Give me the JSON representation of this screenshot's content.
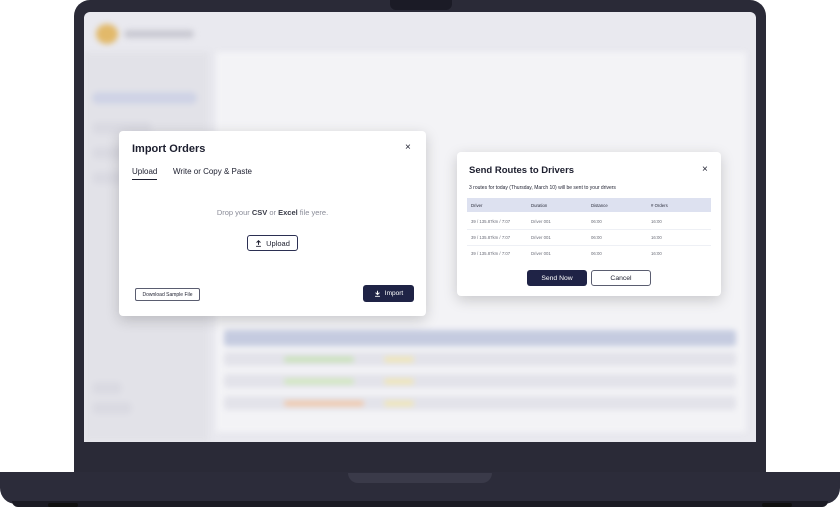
{
  "import_modal": {
    "title": "Import Orders",
    "close_icon": "×",
    "tabs": [
      {
        "label": "Upload",
        "active": true
      },
      {
        "label": "Write or Copy & Paste",
        "active": false
      }
    ],
    "drop_prefix": "Drop your ",
    "drop_csv": "CSV",
    "drop_or": " or ",
    "drop_excel": "Excel",
    "drop_suffix": " file yere.",
    "upload_label": "Upload",
    "upload_icon": "upload-arrow-icon",
    "download_sample_label": "Download Sample File",
    "import_label": "Import",
    "import_icon": "download-arrow-icon"
  },
  "send_modal": {
    "title": "Send Routes to Drivers",
    "close_icon": "×",
    "subtitle": "3 routes for today (Thursday, March 10) will be sent to your drivers",
    "columns": [
      "Driver",
      "Duration",
      "Distance",
      "# Orders"
    ],
    "rows": [
      [
        "39 / 135.87km / 7:07",
        "Driver 001",
        "06:00",
        "16:00"
      ],
      [
        "39 / 135.87km / 7:07",
        "Driver 001",
        "06:00",
        "16:00"
      ],
      [
        "39 / 135.87km / 7:07",
        "Driver 001",
        "06:00",
        "16:00"
      ]
    ],
    "send_label": "Send Now",
    "cancel_label": "Cancel"
  },
  "colors": {
    "primary": "#1f2346",
    "table_header": "#dde1f0",
    "laptop_body": "#2a2a37"
  }
}
